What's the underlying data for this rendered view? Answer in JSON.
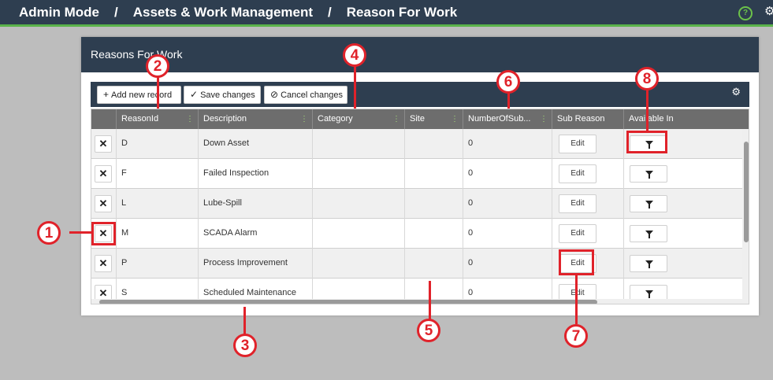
{
  "breadcrumb": {
    "items": [
      "Admin Mode",
      "Assets & Work Management",
      "Reason For Work"
    ],
    "separator": "/"
  },
  "header_icons": [
    "help-circle-icon",
    "gear-icon"
  ],
  "panel": {
    "title": "Reasons For Work"
  },
  "toolbar": {
    "add_label": "Add new record",
    "save_label": "Save changes",
    "cancel_label": "Cancel changes"
  },
  "grid": {
    "columns": [
      "ReasonId",
      "Description",
      "Category",
      "Site",
      "NumberOfSub...",
      "Sub Reason",
      "Available In"
    ],
    "delete_glyph": "✕",
    "edit_label": "Edit",
    "rows": [
      {
        "id": "D",
        "description": "Down Asset",
        "category": "",
        "site": "",
        "num_sub": "0"
      },
      {
        "id": "F",
        "description": "Failed Inspection",
        "category": "",
        "site": "",
        "num_sub": "0"
      },
      {
        "id": "L",
        "description": "Lube-Spill",
        "category": "",
        "site": "",
        "num_sub": "0"
      },
      {
        "id": "M",
        "description": "SCADA Alarm",
        "category": "",
        "site": "",
        "num_sub": "0"
      },
      {
        "id": "P",
        "description": "Process Improvement",
        "category": "",
        "site": "",
        "num_sub": "0"
      },
      {
        "id": "S",
        "description": "Scheduled Maintenance",
        "category": "",
        "site": "",
        "num_sub": "0"
      }
    ]
  },
  "callouts": [
    "1",
    "2",
    "3",
    "4",
    "5",
    "6",
    "7",
    "8"
  ],
  "colors": {
    "header_bg": "#2e3e50",
    "accent_green": "#5ab34a",
    "callout_red": "#e0222a",
    "grid_header": "#6d6d6d"
  }
}
